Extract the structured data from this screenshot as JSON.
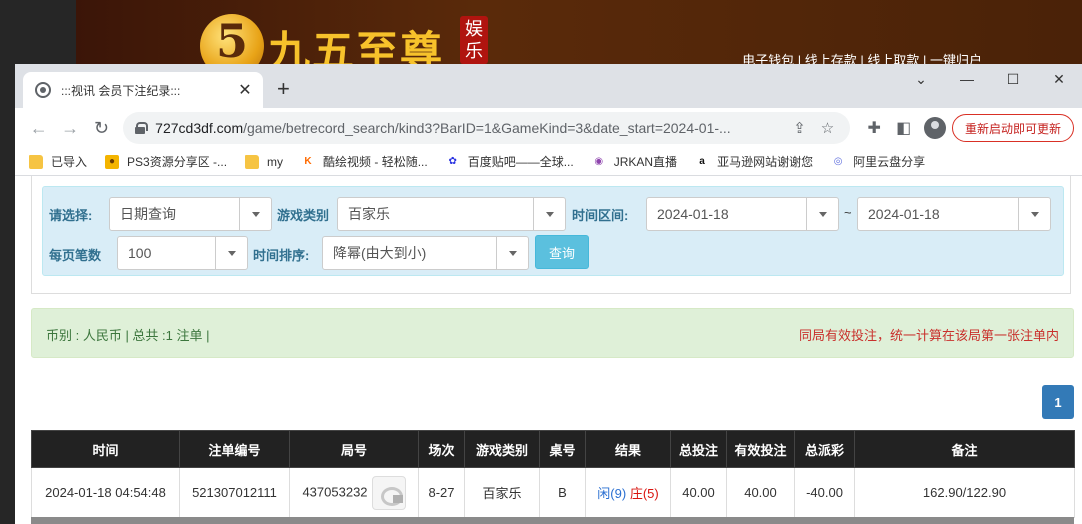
{
  "background_site": {
    "logo_number": "5",
    "logo_text": "九五至尊",
    "logo_badge": "娱乐",
    "nav": "电子钱包 | 线上存款 | 线上取款 | 一键归户"
  },
  "browser": {
    "tab_title": ":::视讯 会员下注纪录:::",
    "tab_close": "✕",
    "new_tab": "+",
    "window_controls": {
      "chevron": "⌄",
      "minimize": "—",
      "maximize": "☐",
      "close": "✕"
    },
    "url_host": "727cd3df.com",
    "url_path": "/game/betrecord_search/kind3?BarID=1&GameKind=3&date_start=2024-01-...",
    "restart_label": "重新启动即可更新",
    "bookmarks": [
      {
        "label": "已导入",
        "icon": "folder-icon"
      },
      {
        "label": "PS3资源分享区 -...",
        "icon": "ps3-site-icon"
      },
      {
        "label": "my",
        "icon": "folder-icon"
      },
      {
        "label": "酷绘视频 - 轻松随...",
        "icon": "video-site-icon"
      },
      {
        "label": "百度贴吧——全球...",
        "icon": "baidu-icon"
      },
      {
        "label": "JRKAN直播",
        "icon": "jrkan-icon"
      },
      {
        "label": "亚马逊网站谢谢您",
        "icon": "amazon-icon"
      },
      {
        "label": "阿里云盘分享",
        "icon": "aliyun-icon"
      }
    ]
  },
  "filters": {
    "select_label": "请选择:",
    "select_value": "日期查询",
    "game_type_label": "游戏类别",
    "game_type_value": "百家乐",
    "time_range_label": "时间区间:",
    "date_start": "2024-01-18",
    "range_sep": "~",
    "date_end": "2024-01-18",
    "per_page_label": "每页笔数",
    "per_page_value": "100",
    "sort_label": "时间排序:",
    "sort_value": "降幂(由大到小)",
    "query_button": "查询"
  },
  "summary": {
    "left": "币别 : 人民币 | 总共 :1 注单 |",
    "right": "同局有效投注，统一计算在该局第一张注单内"
  },
  "pagination": {
    "current_page": "1"
  },
  "table": {
    "headers": [
      "时间",
      "注单编号",
      "局号",
      "场次",
      "游戏类别",
      "桌号",
      "结果",
      "总投注",
      "有效投注",
      "总派彩",
      "备注"
    ],
    "rows": [
      {
        "time": "2024-01-18 04:54:48",
        "bet_id": "521307012111",
        "round_id": "437053232",
        "session": "8-27",
        "game_type": "百家乐",
        "table_no": "B",
        "result_player": "闲(9)",
        "result_banker": "庄(5)",
        "total_bet": "40.00",
        "valid_bet": "40.00",
        "payout": "-40.00",
        "remark": "162.90/122.90"
      }
    ]
  }
}
